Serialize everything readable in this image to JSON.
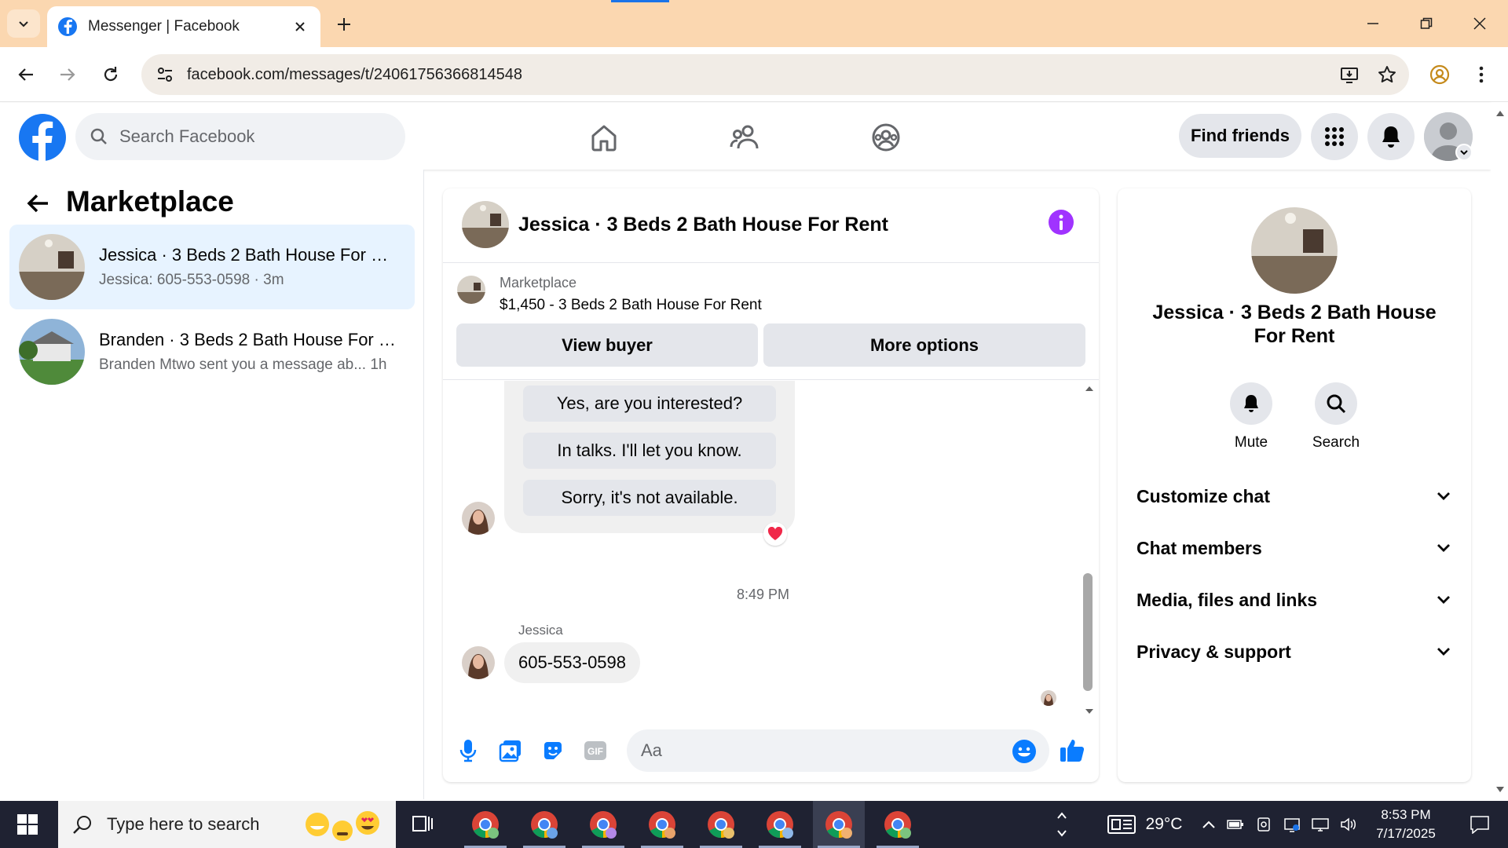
{
  "browser": {
    "tab_title": "Messenger | Facebook",
    "url": "facebook.com/messages/t/24061756366814548"
  },
  "fb_header": {
    "search_placeholder": "Search Facebook",
    "find_friends_label": "Find friends"
  },
  "left_panel": {
    "title": "Marketplace",
    "conversations": [
      {
        "name": "Jessica · 3 Beds 2 Bath House For Rent",
        "preview": "Jessica: 605-553-0598 · 3m",
        "selected": true
      },
      {
        "name": "Branden · 3 Beds 2 Bath House For Rent",
        "preview": "Branden Mtwo sent you a message ab...  1h",
        "selected": false
      }
    ]
  },
  "chat": {
    "title": "Jessica · 3 Beds 2 Bath House For Rent",
    "marketplace_label": "Marketplace",
    "listing": "$1,450 - 3 Beds 2 Bath House For Rent",
    "view_buyer_label": "View buyer",
    "more_options_label": "More options",
    "quick_replies": [
      "Yes, are you interested?",
      "In talks. I'll let you know.",
      "Sorry, it's not available."
    ],
    "reaction": "heart",
    "timestamp": "8:49 PM",
    "sender_name": "Jessica",
    "last_message": "605-553-0598",
    "input_placeholder": "Aa",
    "gif_label": "GIF"
  },
  "right_panel": {
    "name": "Jessica · 3 Beds 2 Bath House For Rent",
    "actions": [
      {
        "label": "Mute",
        "icon": "bell-icon"
      },
      {
        "label": "Search",
        "icon": "search-icon"
      }
    ],
    "sections": [
      "Customize chat",
      "Chat members",
      "Media, files and links",
      "Privacy & support"
    ]
  },
  "taskbar": {
    "search_placeholder": "Type here to search",
    "weather": "29°C",
    "time": "8:53 PM",
    "date": "7/17/2025"
  },
  "colors": {
    "fb_blue": "#1877f2",
    "messenger_purple": "#a033ff",
    "tab_bar": "#fbd7b0",
    "taskbar": "#1f2232"
  }
}
